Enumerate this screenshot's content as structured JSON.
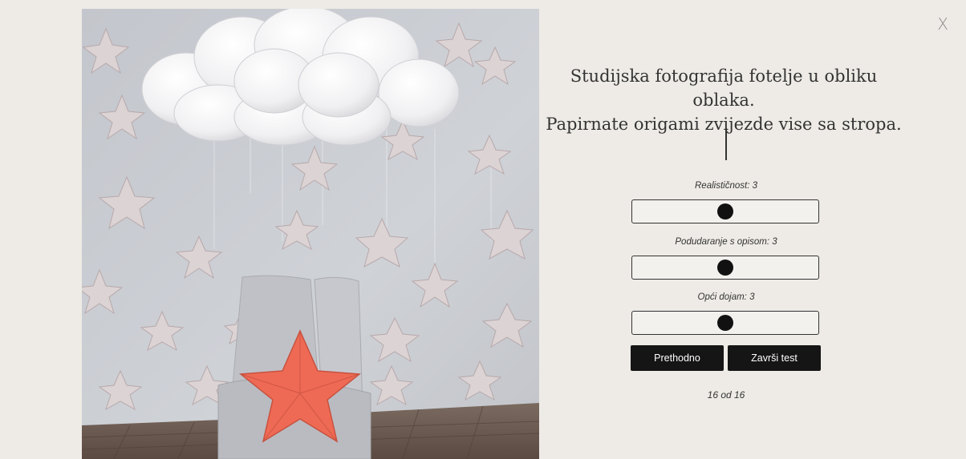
{
  "close": {
    "label": "X"
  },
  "description": {
    "line1": "Studijska fotografija fotelje u obliku oblaka.",
    "line2": "Papirnate origami zvijezde vise sa stropa."
  },
  "ratings": [
    {
      "label": "Realističnost: 3",
      "value": 3,
      "min": 1,
      "max": 5
    },
    {
      "label": "Podudaranje s opisom: 3",
      "value": 3,
      "min": 1,
      "max": 5
    },
    {
      "label": "Opći dojam: 3",
      "value": 3,
      "min": 1,
      "max": 5
    }
  ],
  "buttons": {
    "previous": "Prethodno",
    "finish": "Završi test"
  },
  "progress": {
    "text": "16 od 16",
    "current": 16,
    "total": 16
  },
  "colors": {
    "background": "#eeebe6",
    "button": "#151515",
    "star_accent": "#ee6a55",
    "wall": "#c9ccd2"
  }
}
